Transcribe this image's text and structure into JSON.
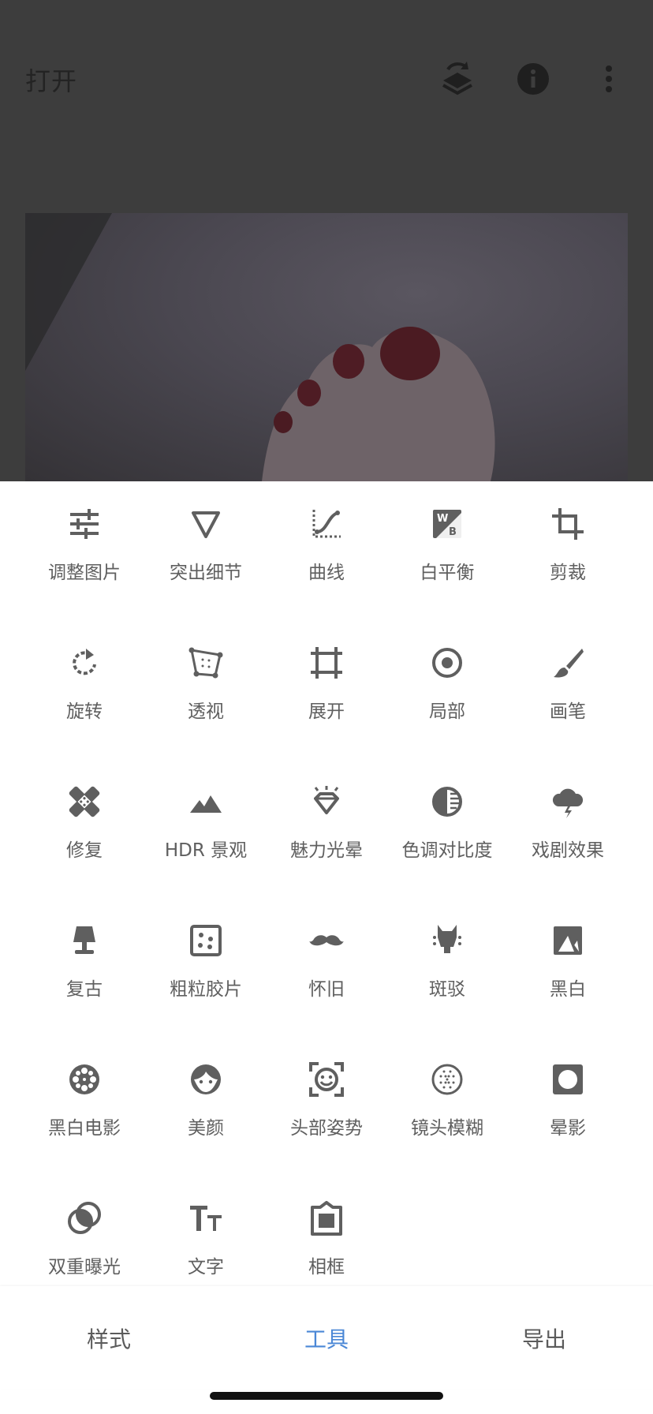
{
  "appbar": {
    "open_label": "打开",
    "icons": [
      "layers-rotate-icon",
      "info-icon",
      "more-vert-icon"
    ]
  },
  "photo": {
    "description_icon": "photo-preview"
  },
  "tools": [
    {
      "label": "调整图片",
      "icon": "tune-sliders-icon"
    },
    {
      "label": "突出细节",
      "icon": "details-triangle-icon"
    },
    {
      "label": "曲线",
      "icon": "curves-icon"
    },
    {
      "label": "白平衡",
      "icon": "white-balance-icon"
    },
    {
      "label": "剪裁",
      "icon": "crop-icon"
    },
    {
      "label": "旋转",
      "icon": "rotate-icon"
    },
    {
      "label": "透视",
      "icon": "perspective-icon"
    },
    {
      "label": "展开",
      "icon": "expand-icon"
    },
    {
      "label": "局部",
      "icon": "selective-icon"
    },
    {
      "label": "画笔",
      "icon": "brush-icon"
    },
    {
      "label": "修复",
      "icon": "healing-icon"
    },
    {
      "label": "HDR 景观",
      "icon": "hdr-landscape-icon"
    },
    {
      "label": "魅力光晕",
      "icon": "glamour-glow-icon"
    },
    {
      "label": "色调对比度",
      "icon": "tonal-contrast-icon"
    },
    {
      "label": "戏剧效果",
      "icon": "drama-icon"
    },
    {
      "label": "复古",
      "icon": "vintage-lamp-icon"
    },
    {
      "label": "粗粒胶片",
      "icon": "grainy-film-icon"
    },
    {
      "label": "怀旧",
      "icon": "retrolux-mustache-icon"
    },
    {
      "label": "斑驳",
      "icon": "grunge-icon"
    },
    {
      "label": "黑白",
      "icon": "black-white-icon"
    },
    {
      "label": "黑白电影",
      "icon": "noir-film-reel-icon"
    },
    {
      "label": "美颜",
      "icon": "face-icon"
    },
    {
      "label": "头部姿势",
      "icon": "head-pose-icon"
    },
    {
      "label": "镜头模糊",
      "icon": "lens-blur-icon"
    },
    {
      "label": "晕影",
      "icon": "vignette-icon"
    },
    {
      "label": "双重曝光",
      "icon": "double-exposure-icon"
    },
    {
      "label": "文字",
      "icon": "text-icon"
    },
    {
      "label": "相框",
      "icon": "frames-icon"
    }
  ],
  "bottom_nav": {
    "styles": "样式",
    "tools": "工具",
    "export": "导出",
    "active": "tools"
  },
  "colors": {
    "accent": "#4a87d6",
    "icon": "#5f5f5f",
    "dim_overlay": "#3d3d3d"
  }
}
